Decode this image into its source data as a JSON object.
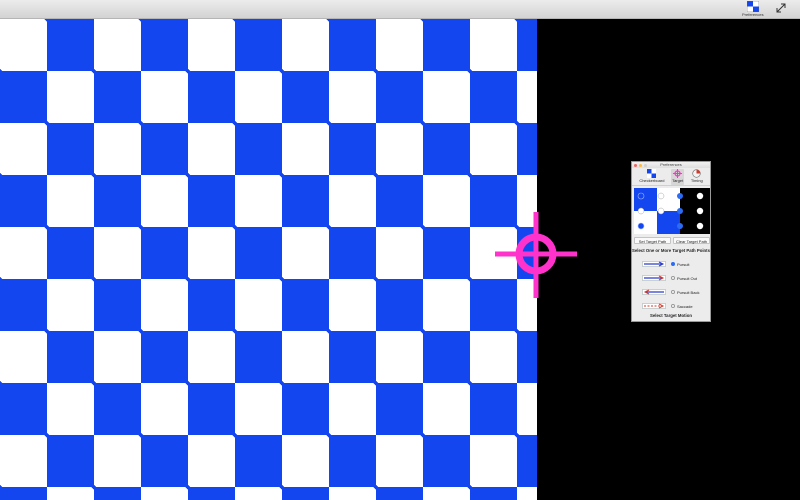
{
  "toolbar": {
    "preferences_label": "Preferences",
    "colors": {
      "bg": "#d9d9d9"
    }
  },
  "stimulus": {
    "checker_colors": [
      "#1446f0",
      "#ffffff"
    ],
    "background_color": "#000000",
    "target_icon": "crosshair-target-icon",
    "target_color": "#ff33cc"
  },
  "prefs": {
    "title": "Preferences",
    "tabs": [
      {
        "label": "Checkerboard",
        "icon": "checkerboard-icon"
      },
      {
        "label": "Target",
        "icon": "target-icon"
      },
      {
        "label": "Timing",
        "icon": "timing-icon"
      }
    ],
    "selected_tab": "Target",
    "set_button": "Set Target Path",
    "clear_button": "Clear Target Path",
    "points_header": "Select One or More Target Path Points",
    "motions": [
      {
        "label": "Pursuit",
        "selected": true
      },
      {
        "label": "Pursuit Out",
        "selected": false
      },
      {
        "label": "Pursuit Back",
        "selected": false
      },
      {
        "label": "Saccade",
        "selected": false
      }
    ],
    "footer": "Select Target Motion"
  }
}
